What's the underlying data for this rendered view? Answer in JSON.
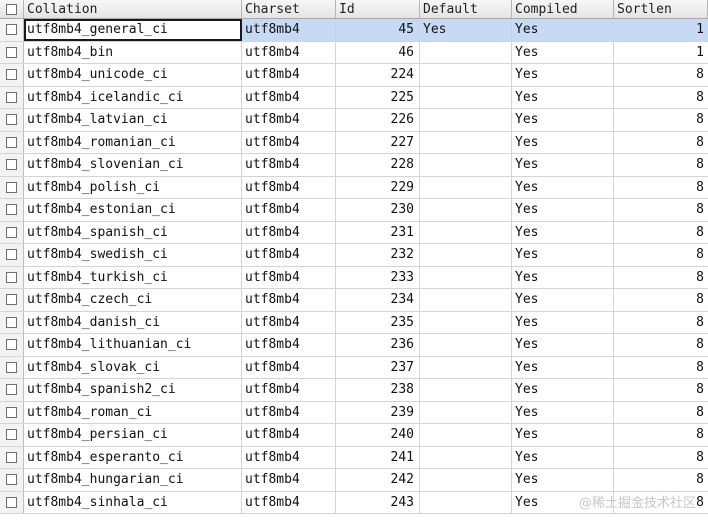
{
  "columns": {
    "collation": "Collation",
    "charset": "Charset",
    "id": "Id",
    "default": "Default",
    "compiled": "Compiled",
    "sortlen": "Sortlen"
  },
  "rows": [
    {
      "collation": "utf8mb4_general_ci",
      "charset": "utf8mb4",
      "id": "45",
      "default": "Yes",
      "compiled": "Yes",
      "sortlen": "1"
    },
    {
      "collation": "utf8mb4_bin",
      "charset": "utf8mb4",
      "id": "46",
      "default": "",
      "compiled": "Yes",
      "sortlen": "1"
    },
    {
      "collation": "utf8mb4_unicode_ci",
      "charset": "utf8mb4",
      "id": "224",
      "default": "",
      "compiled": "Yes",
      "sortlen": "8"
    },
    {
      "collation": "utf8mb4_icelandic_ci",
      "charset": "utf8mb4",
      "id": "225",
      "default": "",
      "compiled": "Yes",
      "sortlen": "8"
    },
    {
      "collation": "utf8mb4_latvian_ci",
      "charset": "utf8mb4",
      "id": "226",
      "default": "",
      "compiled": "Yes",
      "sortlen": "8"
    },
    {
      "collation": "utf8mb4_romanian_ci",
      "charset": "utf8mb4",
      "id": "227",
      "default": "",
      "compiled": "Yes",
      "sortlen": "8"
    },
    {
      "collation": "utf8mb4_slovenian_ci",
      "charset": "utf8mb4",
      "id": "228",
      "default": "",
      "compiled": "Yes",
      "sortlen": "8"
    },
    {
      "collation": "utf8mb4_polish_ci",
      "charset": "utf8mb4",
      "id": "229",
      "default": "",
      "compiled": "Yes",
      "sortlen": "8"
    },
    {
      "collation": "utf8mb4_estonian_ci",
      "charset": "utf8mb4",
      "id": "230",
      "default": "",
      "compiled": "Yes",
      "sortlen": "8"
    },
    {
      "collation": "utf8mb4_spanish_ci",
      "charset": "utf8mb4",
      "id": "231",
      "default": "",
      "compiled": "Yes",
      "sortlen": "8"
    },
    {
      "collation": "utf8mb4_swedish_ci",
      "charset": "utf8mb4",
      "id": "232",
      "default": "",
      "compiled": "Yes",
      "sortlen": "8"
    },
    {
      "collation": "utf8mb4_turkish_ci",
      "charset": "utf8mb4",
      "id": "233",
      "default": "",
      "compiled": "Yes",
      "sortlen": "8"
    },
    {
      "collation": "utf8mb4_czech_ci",
      "charset": "utf8mb4",
      "id": "234",
      "default": "",
      "compiled": "Yes",
      "sortlen": "8"
    },
    {
      "collation": "utf8mb4_danish_ci",
      "charset": "utf8mb4",
      "id": "235",
      "default": "",
      "compiled": "Yes",
      "sortlen": "8"
    },
    {
      "collation": "utf8mb4_lithuanian_ci",
      "charset": "utf8mb4",
      "id": "236",
      "default": "",
      "compiled": "Yes",
      "sortlen": "8"
    },
    {
      "collation": "utf8mb4_slovak_ci",
      "charset": "utf8mb4",
      "id": "237",
      "default": "",
      "compiled": "Yes",
      "sortlen": "8"
    },
    {
      "collation": "utf8mb4_spanish2_ci",
      "charset": "utf8mb4",
      "id": "238",
      "default": "",
      "compiled": "Yes",
      "sortlen": "8"
    },
    {
      "collation": "utf8mb4_roman_ci",
      "charset": "utf8mb4",
      "id": "239",
      "default": "",
      "compiled": "Yes",
      "sortlen": "8"
    },
    {
      "collation": "utf8mb4_persian_ci",
      "charset": "utf8mb4",
      "id": "240",
      "default": "",
      "compiled": "Yes",
      "sortlen": "8"
    },
    {
      "collation": "utf8mb4_esperanto_ci",
      "charset": "utf8mb4",
      "id": "241",
      "default": "",
      "compiled": "Yes",
      "sortlen": "8"
    },
    {
      "collation": "utf8mb4_hungarian_ci",
      "charset": "utf8mb4",
      "id": "242",
      "default": "",
      "compiled": "Yes",
      "sortlen": "8"
    },
    {
      "collation": "utf8mb4_sinhala_ci",
      "charset": "utf8mb4",
      "id": "243",
      "default": "",
      "compiled": "Yes",
      "sortlen": "8"
    }
  ],
  "selected_row": 0,
  "watermark": "@稀土掘金技术社区"
}
